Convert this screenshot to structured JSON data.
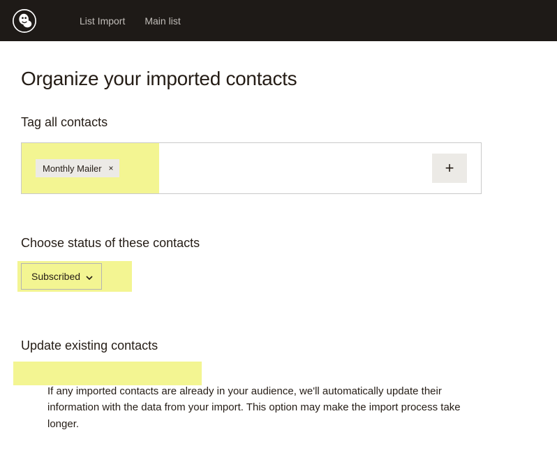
{
  "nav": {
    "items": [
      "List Import",
      "Main list"
    ]
  },
  "page": {
    "title": "Organize your imported contacts"
  },
  "tags": {
    "heading": "Tag all contacts",
    "chip_label": "Monthly Mailer",
    "chip_close": "×",
    "add_glyph": "+"
  },
  "status": {
    "heading": "Choose status of these contacts",
    "selected": "Subscribed"
  },
  "update": {
    "heading": "Update existing contacts",
    "checkbox_label": "Update existing contacts",
    "description": "If any imported contacts are already in your audience, we'll automatically update their information with the data from your import. This option may make the import process take longer."
  }
}
